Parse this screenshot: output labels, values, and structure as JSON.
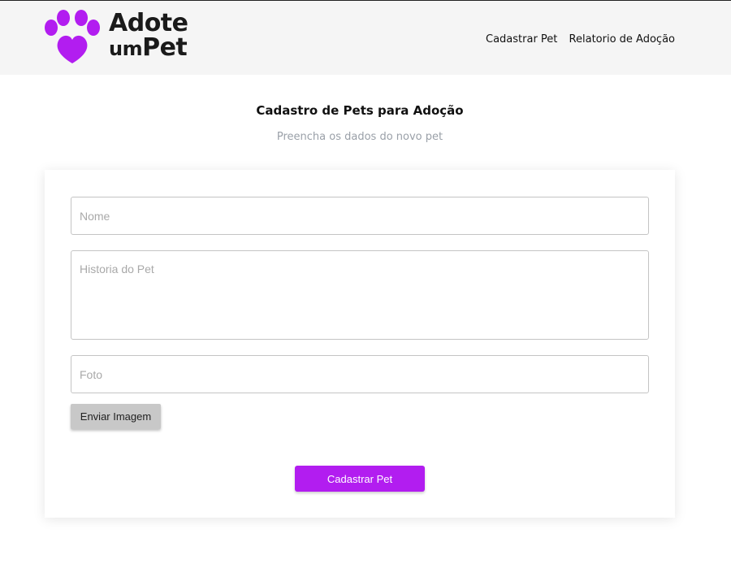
{
  "header": {
    "logo": {
      "line1": "Adote",
      "line2_a": "um",
      "line2_b": "Pet",
      "icon": "paw-icon",
      "icon_color": "#b21df0"
    },
    "nav": [
      "Cadastrar Pet",
      "Relatorio de Adoção"
    ]
  },
  "page": {
    "title": "Cadastro de Pets para Adoção",
    "subtitle": "Preencha os dados do novo pet"
  },
  "form": {
    "nome_placeholder": "Nome",
    "historia_placeholder": "Historia do Pet",
    "foto_placeholder": "Foto",
    "upload_label": "Enviar Imagem",
    "submit_label": "Cadastrar Pet"
  },
  "colors": {
    "accent": "#b21df0",
    "header_bg": "#f5f5f5"
  }
}
